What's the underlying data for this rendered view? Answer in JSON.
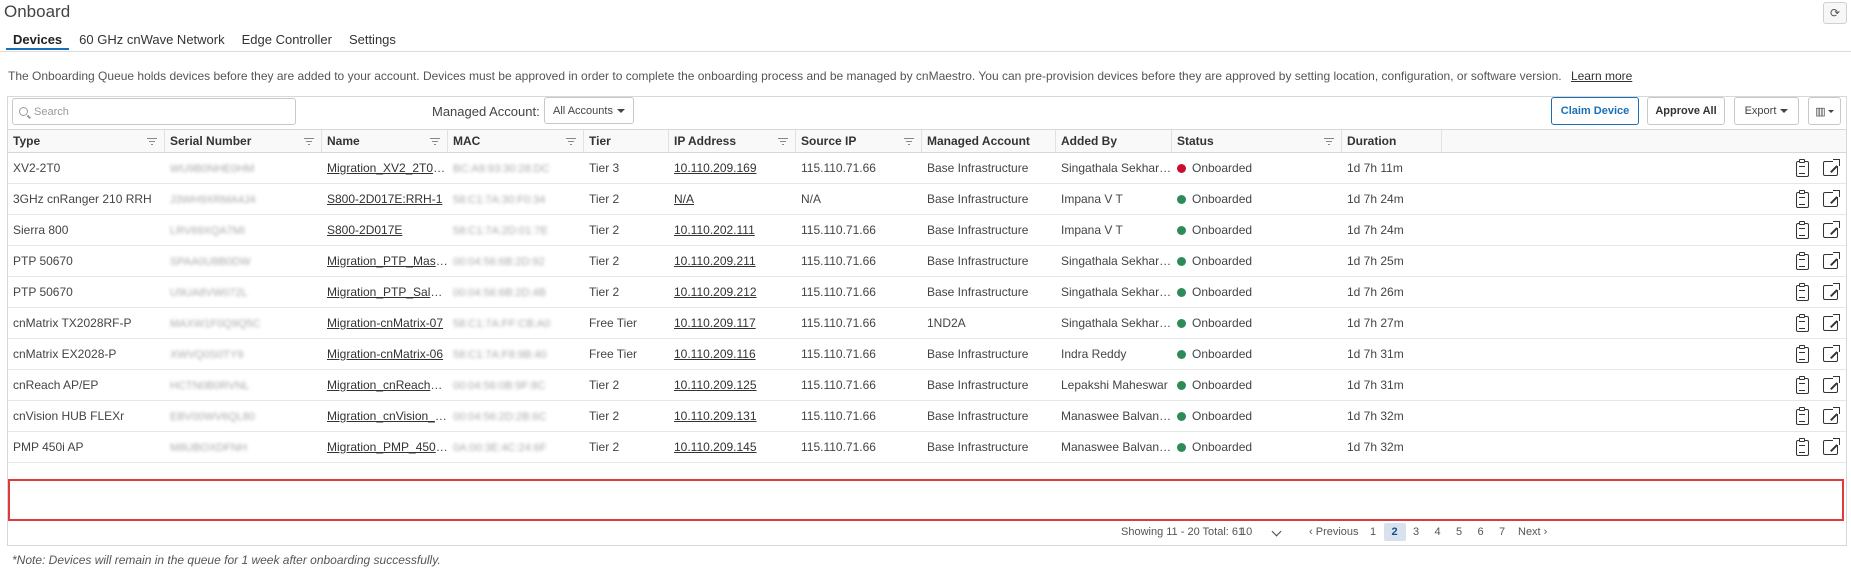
{
  "page": {
    "title": "Onboard"
  },
  "tabs": [
    {
      "label": "Devices",
      "active": true
    },
    {
      "label": "60 GHz cnWave Network",
      "active": false
    },
    {
      "label": "Edge Controller",
      "active": false
    },
    {
      "label": "Settings",
      "active": false
    }
  ],
  "info": {
    "text": "The Onboarding Queue holds devices before they are added to your account. Devices must be approved in order to complete the onboarding process and be managed by cnMaestro. You can pre-provision devices before they are approved by setting location, configuration, or software version.",
    "learn_more": "Learn more"
  },
  "toolbar": {
    "search_placeholder": "Search",
    "managed_account_label": "Managed Account:",
    "managed_account_value": "All Accounts",
    "claim_label": "Claim Device",
    "approve_label": "Approve All",
    "export_label": "Export"
  },
  "columns": [
    "Type",
    "Serial Number",
    "Name",
    "MAC",
    "Tier",
    "IP Address",
    "Source IP",
    "Managed Account",
    "Added By",
    "Status",
    "Duration"
  ],
  "rows": [
    {
      "type": "XV2-2T0",
      "serial": "WU9B0NHE0HM",
      "name": "Migration_XV2_2T0_...",
      "mac": "BC:A9:93:30:28:DC",
      "tier": "Tier 3",
      "ip": "10.110.209.169",
      "source_ip": "115.110.71.66",
      "account": "Base Infrastructure",
      "added_by": "Singathala Sekhar r...",
      "status": "Onboarded",
      "status_color": "#c8102e",
      "duration": "1d 7h 11m"
    },
    {
      "type": "3GHz cnRanger 210 RRH",
      "serial": "J3WH9XRMA4J4",
      "name": "S800-2D017E:RRH-1",
      "mac": "58:C1:7A:30:F0:34",
      "tier": "Tier 2",
      "ip": "N/A",
      "source_ip": "N/A",
      "account": "Base Infrastructure",
      "added_by": "Impana V T",
      "status": "Onboarded",
      "status_color": "#2e8b57",
      "duration": "1d 7h 24m"
    },
    {
      "type": "Sierra 800",
      "serial": "LRV69XQA7MI",
      "name": "S800-2D017E",
      "mac": "58:C1:7A:2D:01:7E",
      "tier": "Tier 2",
      "ip": "10.110.202.111",
      "source_ip": "115.110.71.66",
      "account": "Base Infrastructure",
      "added_by": "Impana V T",
      "status": "Onboarded",
      "status_color": "#2e8b57",
      "duration": "1d 7h 24m"
    },
    {
      "type": "PTP 50670",
      "serial": "SPAA0U8B0DW",
      "name": "Migration_PTP_Maste...",
      "mac": "00:04:56:6B:2D:92",
      "tier": "Tier 2",
      "ip": "10.110.209.211",
      "source_ip": "115.110.71.66",
      "account": "Base Infrastructure",
      "added_by": "Singathala Sekhar r...",
      "status": "Onboarded",
      "status_color": "#2e8b57",
      "duration": "1d 7h 25m"
    },
    {
      "type": "PTP 50670",
      "serial": "U9UA8VW072L",
      "name": "Migration_PTP_Salve_...",
      "mac": "00:04:56:6B:2D:4B",
      "tier": "Tier 2",
      "ip": "10.110.209.212",
      "source_ip": "115.110.71.66",
      "account": "Base Infrastructure",
      "added_by": "Singathala Sekhar r...",
      "status": "Onboarded",
      "status_color": "#2e8b57",
      "duration": "1d 7h 26m"
    },
    {
      "type": "cnMatrix TX2028RF-P",
      "serial": "MAXW1F0Q9Q5C",
      "name": "Migration-cnMatrix-07",
      "mac": "58:C1:7A:FF:CB:A0",
      "tier": "Free Tier",
      "ip": "10.110.209.117",
      "source_ip": "115.110.71.66",
      "account": "1ND2A",
      "added_by": "Singathala Sekhar r...",
      "status": "Onboarded",
      "status_color": "#2e8b57",
      "duration": "1d 7h 27m"
    },
    {
      "type": "cnMatrix EX2028-P",
      "serial": "XWVQ0S0TY9",
      "name": "Migration-cnMatrix-06",
      "mac": "58:C1:7A:F8:9B:40",
      "tier": "Free Tier",
      "ip": "10.110.209.116",
      "source_ip": "115.110.71.66",
      "account": "Base Infrastructure",
      "added_by": "Indra Reddy",
      "status": "Onboarded",
      "status_color": "#2e8b57",
      "duration": "1d 7h 31m"
    },
    {
      "type": "cnReach AP/EP",
      "serial": "HCTN0B0RVNL",
      "name": "Migration_cnReach_05",
      "mac": "00:04:56:0B:9F:8C",
      "tier": "Tier 2",
      "ip": "10.110.209.125",
      "source_ip": "115.110.71.66",
      "account": "Base Infrastructure",
      "added_by": "Lepakshi Maheswar",
      "status": "Onboarded",
      "status_color": "#2e8b57",
      "duration": "1d 7h 31m"
    },
    {
      "type": "cnVision HUB FLEXr",
      "serial": "EBV00WV6QL80",
      "name": "Migration_cnVision_H...",
      "mac": "00:04:56:2D:2B:6C",
      "tier": "Tier 2",
      "ip": "10.110.209.131",
      "source_ip": "115.110.71.66",
      "account": "Base Infrastructure",
      "added_by": "Manaswee Balvant ...",
      "status": "Onboarded",
      "status_color": "#2e8b57",
      "duration": "1d 7h 32m"
    },
    {
      "type": "PMP 450i AP",
      "serial": "M8UBOXDFNH",
      "name": "Migration_PMP_450i_...",
      "mac": "0A:00:3E:4C:24:6F",
      "tier": "Tier 2",
      "ip": "10.110.209.145",
      "source_ip": "115.110.71.66",
      "account": "Base Infrastructure",
      "added_by": "Manaswee Balvant ...",
      "status": "Onboarded",
      "status_color": "#2e8b57",
      "duration": "1d 7h 32m"
    }
  ],
  "pagination": {
    "showing": "Showing 11 - 20 Total: 61",
    "page_size": "10",
    "prev": "Previous",
    "next": "Next",
    "pages": [
      "1",
      "2",
      "3",
      "4",
      "5",
      "6",
      "7"
    ],
    "current": "2"
  },
  "note": "*Note: Devices will remain in the queue for 1 week after onboarding successfully."
}
